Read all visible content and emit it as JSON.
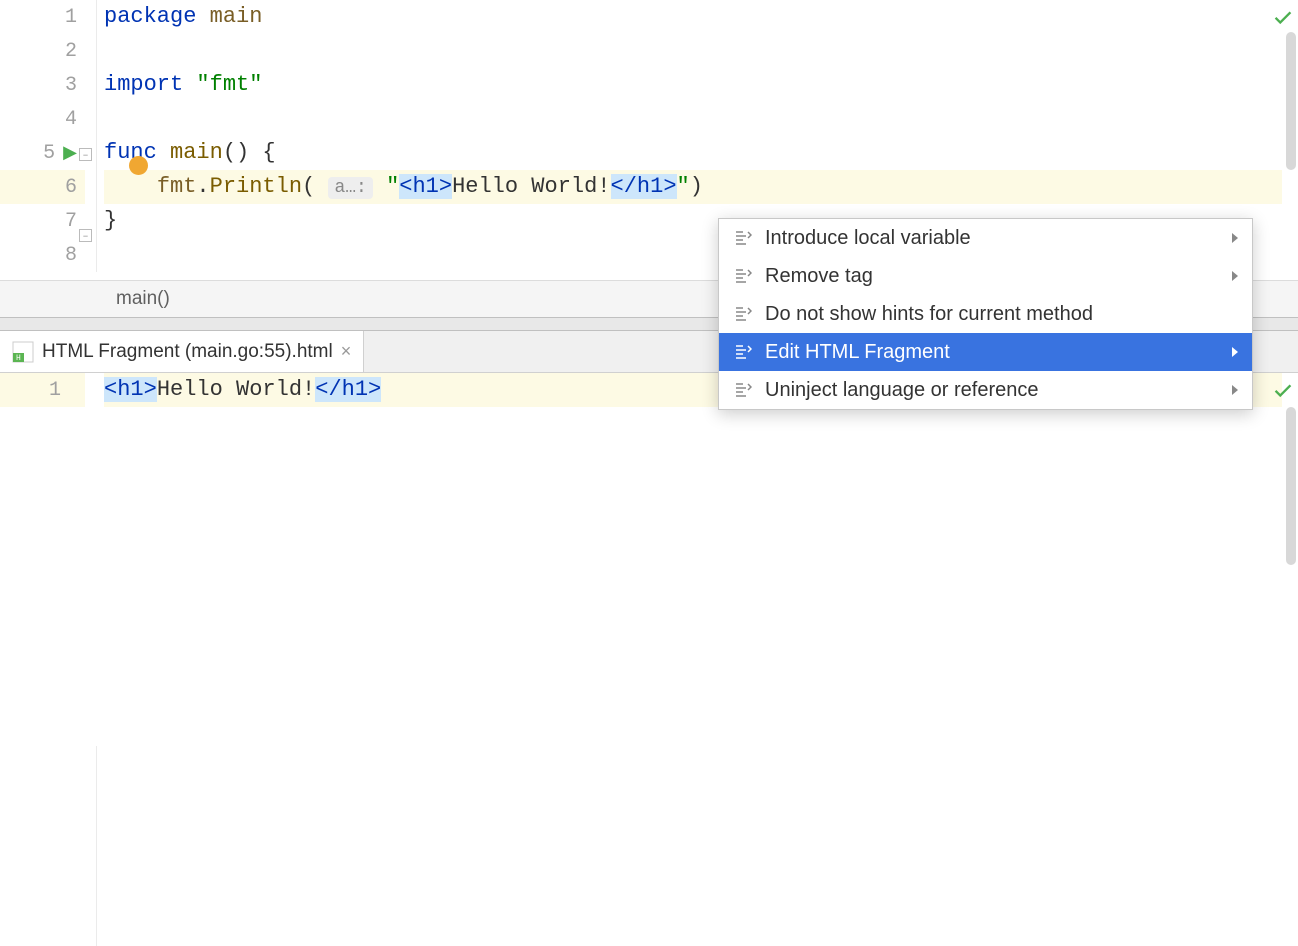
{
  "editor": {
    "gutter": [
      "1",
      "2",
      "3",
      "4",
      "5",
      "6",
      "7",
      "8"
    ],
    "highlighted_line_index": 5,
    "run_icon_line_index": 4,
    "code": {
      "l1": {
        "kw": "package ",
        "pkg": "main"
      },
      "l3": {
        "kw": "import ",
        "str": "\"fmt\""
      },
      "l5": {
        "kw": "func ",
        "fn": "main",
        "rest": "() {"
      },
      "l6": {
        "indent": "    ",
        "obj": "fmt",
        "dot": ".",
        "call": "Println",
        "paren_open": "( ",
        "hint": "a…:",
        "space": " ",
        "quote_open": "\"",
        "tag_open": "<h1>",
        "text": "Hello World!",
        "tag_close": "</h1>",
        "quote_close": "\"",
        "paren_close": ")"
      },
      "l7": {
        "brace": "}"
      }
    }
  },
  "breadcrumb": {
    "text": "main()"
  },
  "tab": {
    "label": "HTML Fragment (main.go:55).html",
    "close": "×"
  },
  "fragment": {
    "gutter": [
      "1"
    ],
    "code": {
      "tag_open": "<h1>",
      "text": "Hello World!",
      "tag_close": "</h1>"
    }
  },
  "menu": {
    "items": [
      {
        "label": "Introduce local variable",
        "arrow": true
      },
      {
        "label": "Remove tag",
        "arrow": true
      },
      {
        "label": "Do not show hints for current method",
        "arrow": false
      },
      {
        "label": "Edit HTML Fragment",
        "arrow": true,
        "selected": true
      },
      {
        "label": "Uninject language or reference",
        "arrow": true
      }
    ]
  }
}
